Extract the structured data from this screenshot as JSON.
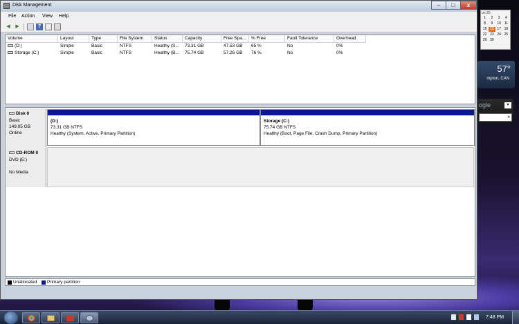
{
  "window": {
    "title": "Disk Management",
    "controls": {
      "minimize": "–",
      "maximize": "□",
      "close": "x"
    }
  },
  "menu": [
    "File",
    "Action",
    "View",
    "Help"
  ],
  "toolbar": {
    "icons": [
      "back-icon",
      "forward-icon",
      "properties-icon",
      "help-icon",
      "refresh-icon",
      "disk-view-icon"
    ]
  },
  "volume_list": {
    "columns": [
      "Volume",
      "Layout",
      "Type",
      "File System",
      "Status",
      "Capacity",
      "Free Spa...",
      "% Free",
      "Fault Tolerance",
      "Overhead"
    ],
    "rows": [
      [
        "(D:)",
        "Simple",
        "Basic",
        "NTFS",
        "Healthy (S...",
        "73.31 GB",
        "47.53 GB",
        "65 %",
        "No",
        "0%"
      ],
      [
        "Storage (C:)",
        "Simple",
        "Basic",
        "NTFS",
        "Healthy (B...",
        "75.74 GB",
        "57.26 GB",
        "76 %",
        "No",
        "0%"
      ]
    ]
  },
  "disks": [
    {
      "name": "Disk 0",
      "type": "Basic",
      "size": "149.05 GB",
      "status": "Online",
      "partitions": [
        {
          "name": "(D:)",
          "size": "73.31 GB NTFS",
          "status": "Healthy (System, Active, Primary Partition)"
        },
        {
          "name": "Storage  (C:)",
          "size": "75.74 GB NTFS",
          "status": "Healthy (Boot, Page File, Crash Dump, Primary Partition)"
        }
      ]
    },
    {
      "name": "CD-ROM 0",
      "type": "DVD (E:)",
      "status": "No Media"
    }
  ],
  "legend": [
    {
      "label": "Unallocated",
      "color": "#000000"
    },
    {
      "label": "Primary partition",
      "color": "#0a1a8c"
    }
  ],
  "gadgets": {
    "calendar": {
      "header": "un 20",
      "days": [
        "1",
        "2",
        "3",
        "4",
        "8",
        "9",
        "10",
        "11",
        "15",
        "16",
        "17",
        "18",
        "22",
        "23",
        "24",
        "25",
        "29",
        "30"
      ],
      "today": "16"
    },
    "weather": {
      "temperature": "57°",
      "location": "mpton, CAN"
    },
    "search": {
      "logo": "ogle",
      "dropdown": "▾",
      "go": "»"
    }
  },
  "taskbar": {
    "apps": [
      "chrome-icon",
      "explorer-icon",
      "toolbox-icon",
      "disk-management-icon"
    ],
    "clock": "7:48 PM"
  }
}
